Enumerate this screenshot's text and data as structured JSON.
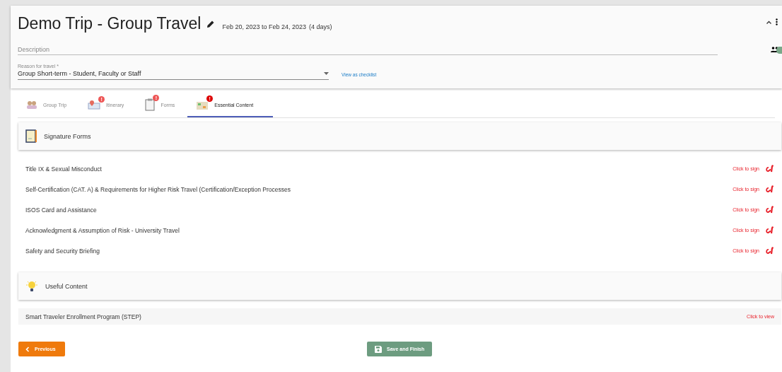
{
  "trip": {
    "title": "Demo Trip - Group Travel",
    "dates": "Feb 20, 2023 to Feb 24, 2023",
    "duration": "(4 days)",
    "description": {
      "placeholder": "Description"
    },
    "reason": {
      "label": "Reason for travel *",
      "value": "Group Short-term - Student, Faculty or Staff"
    },
    "checklist_link": "View as checklist"
  },
  "tabs": [
    {
      "label": "Group Trip",
      "selected": false
    },
    {
      "label": "Itinerary",
      "badge": "!",
      "selected": false
    },
    {
      "label": "Forms",
      "badge": "!",
      "selected": false
    },
    {
      "label": "Essential Content",
      "badge": "!",
      "selected": true
    }
  ],
  "sections": [
    {
      "title": "Signature Forms",
      "items": [
        {
          "name": "Title IX & Sexual Misconduct",
          "action": "Click to sign",
          "kind": "sign"
        },
        {
          "name": "Self-Certification (CAT. A) & Requirements for Higher Risk Travel (Certification/Exception Processes",
          "action": "Click to sign",
          "kind": "sign"
        },
        {
          "name": "ISOS Card and Assistance",
          "action": "Click to sign",
          "kind": "sign"
        },
        {
          "name": "Acknowledgment & Assumption of Risk - University Travel",
          "action": "Click to sign",
          "kind": "sign"
        },
        {
          "name": "Safety and Security Briefing",
          "action": "Click to sign",
          "kind": "sign"
        }
      ]
    },
    {
      "title": "Useful Content",
      "items": [
        {
          "name": "Smart Traveler Enrollment Program (STEP)",
          "action": "Click to view",
          "kind": "view"
        }
      ]
    }
  ],
  "buttons": {
    "previous": "Previous",
    "save": "Save and Finish"
  }
}
